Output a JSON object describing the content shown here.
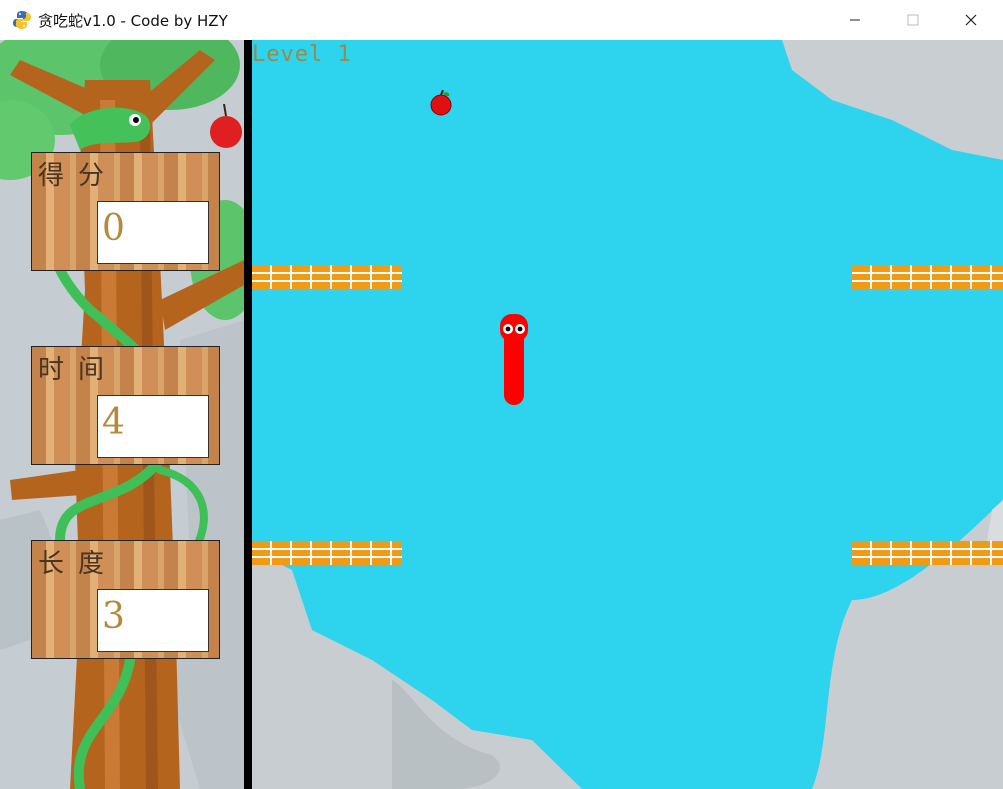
{
  "window": {
    "title": "贪吃蛇v1.0 - Code by HZY",
    "min_glyph": "—",
    "max_glyph": "☐",
    "close_glyph": "✕",
    "icon": "python-snake-icon"
  },
  "hud": {
    "level_text": "Level  1",
    "score_label": "得分",
    "score_value": "0",
    "time_label": "时间",
    "time_value": "4",
    "length_label": "长度",
    "length_value": "3"
  },
  "colors": {
    "water": "#2ed3ee",
    "land": "#c5cdd2",
    "brick": "#f29a14",
    "snake": "#ff0000",
    "apple": "#e01010"
  },
  "game": {
    "snake_direction": "up",
    "apple_icon": "apple-icon",
    "wall_icon": "brick-wall"
  }
}
